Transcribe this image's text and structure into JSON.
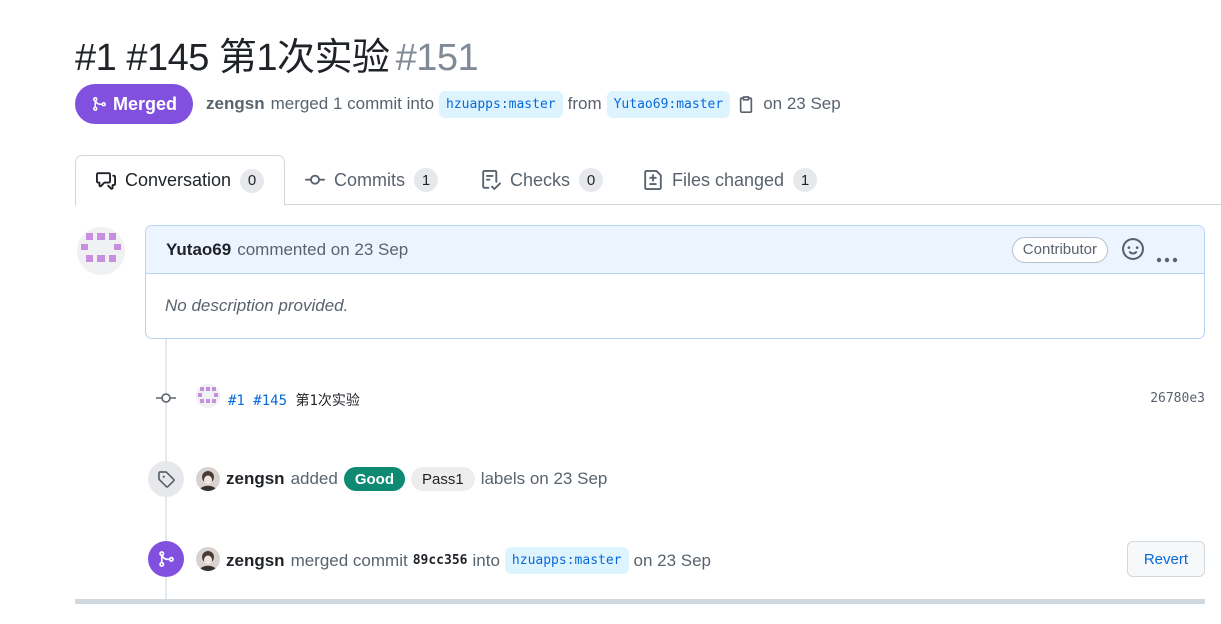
{
  "pr": {
    "title": "#1 #145 第1次实验",
    "number": "#151",
    "state": "Merged",
    "author": "zengsn",
    "merged_text": "merged 1 commit into",
    "base_branch": "hzuapps:master",
    "from_text": "from",
    "head_branch": "Yutao69:master",
    "date_text": "on 23 Sep"
  },
  "tabs": [
    {
      "label": "Conversation",
      "count": "0",
      "icon": "comment-discussion-icon"
    },
    {
      "label": "Commits",
      "count": "1",
      "icon": "git-commit-icon"
    },
    {
      "label": "Checks",
      "count": "0",
      "icon": "checklist-icon"
    },
    {
      "label": "Files changed",
      "count": "1",
      "icon": "file-diff-icon"
    }
  ],
  "comment": {
    "author": "Yutao69",
    "meta": "commented on 23 Sep",
    "role": "Contributor",
    "body": "No description provided."
  },
  "commit": {
    "message_link_1": "#1",
    "message_link_2": "#145",
    "message_rest": "第1次实验",
    "sha": "26780e3"
  },
  "label_event": {
    "author": "zengsn",
    "action": "added",
    "labels": [
      "Good",
      "Pass1"
    ],
    "suffix": "labels on 23 Sep"
  },
  "merge_event": {
    "author": "zengsn",
    "action": "merged commit",
    "sha": "89cc356",
    "into": "into",
    "branch": "hzuapps:master",
    "date": "on 23 Sep",
    "revert_label": "Revert"
  },
  "colors": {
    "merged_purple": "#8250df",
    "link_blue": "#0969da",
    "good_label": "#0e8a73"
  }
}
